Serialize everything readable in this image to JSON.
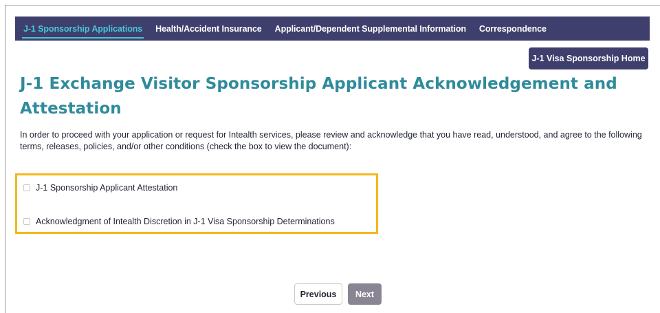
{
  "nav": {
    "tabs": [
      {
        "label": "J-1 Sponsorship Applications",
        "active": true
      },
      {
        "label": "Health/Accident Insurance",
        "active": false
      },
      {
        "label": "Applicant/Dependent Supplemental Information",
        "active": false
      },
      {
        "label": "Correspondence",
        "active": false
      }
    ]
  },
  "header": {
    "home_button_label": "J-1 Visa Sponsorship Home"
  },
  "main": {
    "title": "J-1 Exchange Visitor Sponsorship Applicant Acknowledgement and Attestation",
    "intro": "In order to proceed with your application or request for Intealth services, please review and acknowledge that you have read, understood, and agree to the following terms, releases, policies, and/or other conditions (check the box to view the document):",
    "acknowledgements": [
      {
        "label": "J-1 Sponsorship Applicant Attestation",
        "checked": false
      },
      {
        "label": "Acknowledgment of Intealth Discretion in J-1 Visa Sponsorship Determinations",
        "checked": false
      }
    ]
  },
  "footer": {
    "previous_label": "Previous",
    "next_label": "Next"
  },
  "colors": {
    "nav_background": "#3f3f6e",
    "active_tab": "#47c6d6",
    "title": "#2f8b9b",
    "highlight_border": "#f3b81c",
    "next_disabled": "#8a8592"
  }
}
